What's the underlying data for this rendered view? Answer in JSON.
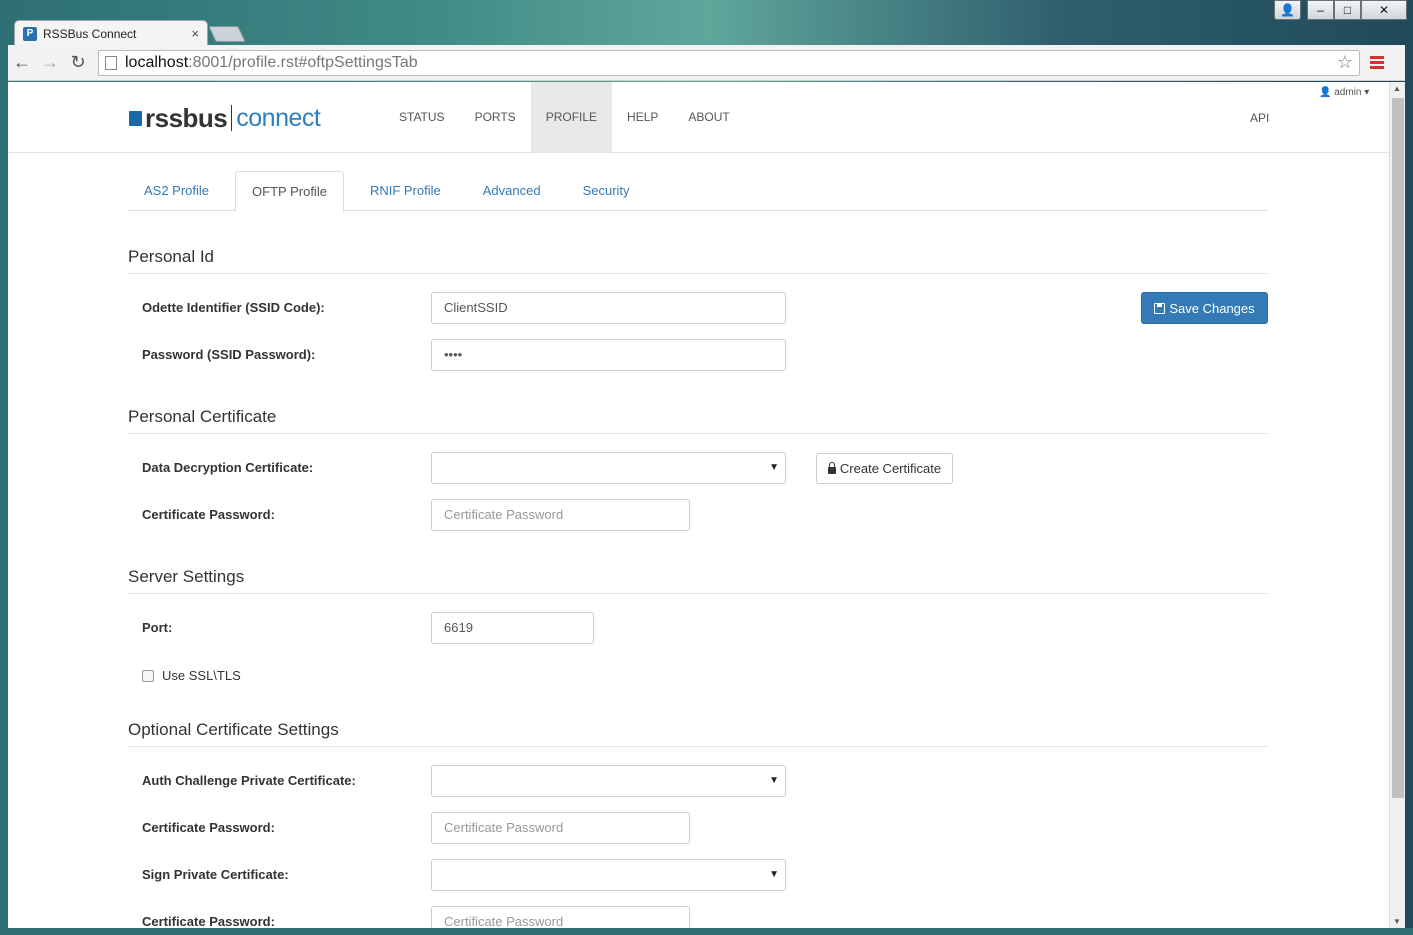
{
  "browser": {
    "tab_title": "RSSBus Connect",
    "tab_close": "×",
    "url_host": "localhost",
    "url_rest": ":8001/profile.rst#oftpSettingsTab",
    "star": "☆",
    "back": "←",
    "forward": "→",
    "reload": "↻",
    "win_minimize": "–",
    "win_maximize": "□",
    "win_close": "✕",
    "win_user": "👤"
  },
  "header": {
    "logo_word": "rssbus",
    "logo_connect": "connect",
    "nav": [
      "STATUS",
      "PORTS",
      "PROFILE",
      "HELP",
      "ABOUT"
    ],
    "active_nav": "PROFILE",
    "api": "API",
    "admin": "👤 admin ▾"
  },
  "subtabs": [
    "AS2 Profile",
    "OFTP Profile",
    "RNIF Profile",
    "Advanced",
    "Security"
  ],
  "active_subtab": "OFTP Profile",
  "personal_id": {
    "title": "Personal Id",
    "ssid_label": "Odette Identifier (SSID Code):",
    "ssid_value": "ClientSSID",
    "password_label": "Password (SSID Password):",
    "password_value": "••••",
    "save_button": "Save Changes"
  },
  "personal_cert": {
    "title": "Personal Certificate",
    "decryption_label": "Data Decryption Certificate:",
    "decryption_value": "",
    "create_button": "Create Certificate",
    "cert_password_label": "Certificate Password:",
    "cert_password_placeholder": "Certificate Password"
  },
  "server": {
    "title": "Server Settings",
    "port_label": "Port:",
    "port_value": "6619",
    "ssl_label": "Use SSL\\TLS",
    "ssl_checked": false
  },
  "optional_cert": {
    "title": "Optional Certificate Settings",
    "auth_label": "Auth Challenge Private Certificate:",
    "auth_value": "",
    "auth_password_label": "Certificate Password:",
    "auth_password_placeholder": "Certificate Password",
    "sign_label": "Sign Private Certificate:",
    "sign_value": "",
    "sign_password_label": "Certificate Password:",
    "sign_password_placeholder": "Certificate Password"
  }
}
